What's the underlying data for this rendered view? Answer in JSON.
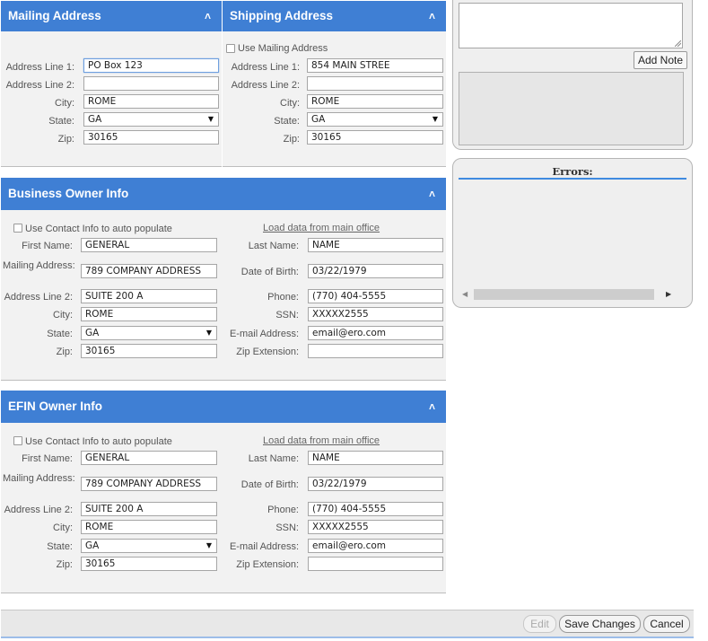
{
  "mailing": {
    "title": "Mailing Address",
    "labels": {
      "line1": "Address Line 1:",
      "line2": "Address Line 2:",
      "city": "City:",
      "state": "State:",
      "zip": "Zip:"
    },
    "values": {
      "line1": "PO Box 123",
      "line2": "",
      "city": "ROME",
      "state": "GA",
      "zip": "30165"
    }
  },
  "shipping": {
    "title": "Shipping Address",
    "use_mailing_label": "Use Mailing Address",
    "labels": {
      "line1": "Address Line 1:",
      "line2": "Address Line 2:",
      "city": "City:",
      "state": "State:",
      "zip": "Zip:"
    },
    "values": {
      "line1": "854 MAIN STREE",
      "line2": "",
      "city": "ROME",
      "state": "GA",
      "zip": "30165"
    }
  },
  "notes": {
    "add_note_label": "Add Note"
  },
  "errors": {
    "title": "Errors:"
  },
  "business_owner": {
    "title": "Business Owner Info",
    "use_contact_label": "Use Contact Info to auto populate",
    "load_link": "Load data from main office",
    "labels": {
      "first_name": "First Name:",
      "mailing_address": "Mailing Address:",
      "line2": "Address Line 2:",
      "city": "City:",
      "state": "State:",
      "zip": "Zip:",
      "last_name": "Last Name:",
      "dob": "Date of Birth:",
      "phone": "Phone:",
      "ssn": "SSN:",
      "email": "E-mail Address:",
      "zip_ext": "Zip Extension:"
    },
    "values": {
      "first_name": "GENERAL",
      "mailing_address": "789 COMPANY ADDRESS",
      "line2": "SUITE 200 A",
      "city": "ROME",
      "state": "GA",
      "zip": "30165",
      "last_name": "NAME",
      "dob": "03/22/1979",
      "phone": "(770) 404-5555",
      "ssn": "XXXXX2555",
      "email": "email@ero.com",
      "zip_ext": ""
    }
  },
  "efin_owner": {
    "title": "EFIN Owner Info",
    "use_contact_label": "Use Contact Info to auto populate",
    "load_link": "Load data from main office",
    "labels": {
      "first_name": "First Name:",
      "mailing_address": "Mailing Address:",
      "line2": "Address Line 2:",
      "city": "City:",
      "state": "State:",
      "zip": "Zip:",
      "last_name": "Last Name:",
      "dob": "Date of Birth:",
      "phone": "Phone:",
      "ssn": "SSN:",
      "email": "E-mail Address:",
      "zip_ext": "Zip Extension:"
    },
    "values": {
      "first_name": "GENERAL",
      "mailing_address": "789 COMPANY ADDRESS",
      "line2": "SUITE 200 A",
      "city": "ROME",
      "state": "GA",
      "zip": "30165",
      "last_name": "NAME",
      "dob": "03/22/1979",
      "phone": "(770) 404-5555",
      "ssn": "XXXXX2555",
      "email": "email@ero.com",
      "zip_ext": ""
    }
  },
  "footer": {
    "edit_label": "Edit",
    "save_label": "Save Changes",
    "cancel_label": "Cancel"
  },
  "icons": {
    "collapse": "chevron-up-icon",
    "dropdown": "caret-down-icon",
    "scroll_left": "arrow-left-icon",
    "scroll_right": "arrow-right-icon"
  },
  "colors": {
    "header_blue": "#3f7fd4",
    "panel_bg": "#f2f2f2",
    "accent_line": "#3f8ae0"
  }
}
